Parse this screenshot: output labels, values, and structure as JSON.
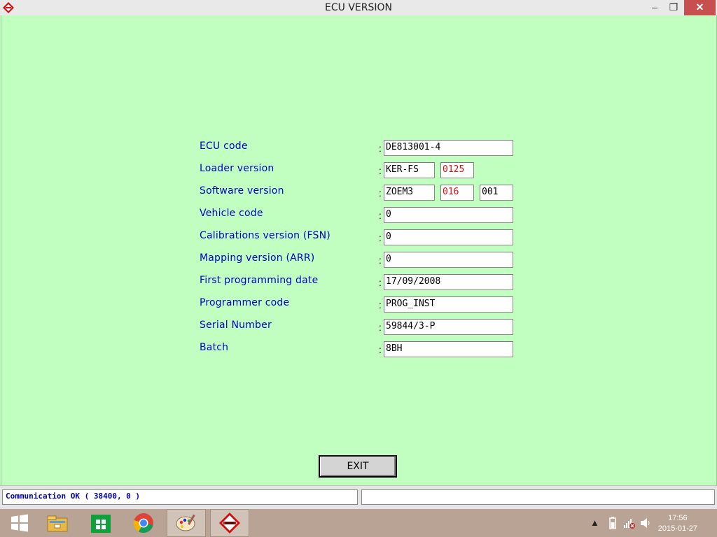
{
  "window": {
    "title": "ECU VERSION",
    "minimize": "‒",
    "restore": "❐",
    "close": "✕"
  },
  "fields": [
    {
      "label": "ECU code",
      "colon": ":",
      "values": [
        "DE813001-4"
      ]
    },
    {
      "label": "Loader version",
      "colon": ":",
      "values": [
        "KER-FS",
        "0125"
      ]
    },
    {
      "label": "Software version",
      "colon": ":",
      "values": [
        "ZOEM3",
        "016",
        "001"
      ]
    },
    {
      "label": "Vehicle code",
      "colon": ":",
      "values": [
        "0"
      ]
    },
    {
      "label": "Calibrations version (FSN)",
      "colon": ":",
      "values": [
        "0"
      ]
    },
    {
      "label": "Mapping version (ARR)",
      "colon": ":",
      "values": [
        "0"
      ]
    },
    {
      "label": "First programming date",
      "colon": ":",
      "values": [
        "17/09/2008"
      ]
    },
    {
      "label": "Programmer code",
      "colon": ":",
      "values": [
        "PROG_INST"
      ]
    },
    {
      "label": "Serial Number",
      "colon": ":",
      "values": [
        "59844/3-P"
      ]
    },
    {
      "label": "Batch",
      "colon": ":",
      "values": [
        "8BH"
      ]
    }
  ],
  "exit_label": "EXIT",
  "status": {
    "pane1": "Communication OK ( 38400,  0 )",
    "pane2": ""
  },
  "taskbar": {
    "items": [
      {
        "icon": "windows-start-icon"
      },
      {
        "icon": "file-explorer-icon"
      },
      {
        "icon": "store-icon"
      },
      {
        "icon": "chrome-icon"
      },
      {
        "icon": "paint-icon"
      },
      {
        "icon": "diagnostic-app-icon"
      }
    ],
    "clock_time": "17:56",
    "clock_date": "2015-01-27"
  },
  "colors": {
    "background": "#c0ffc0",
    "label": "#0000c8",
    "highlight_value": "#e01010",
    "close_button": "#c74f4f"
  }
}
